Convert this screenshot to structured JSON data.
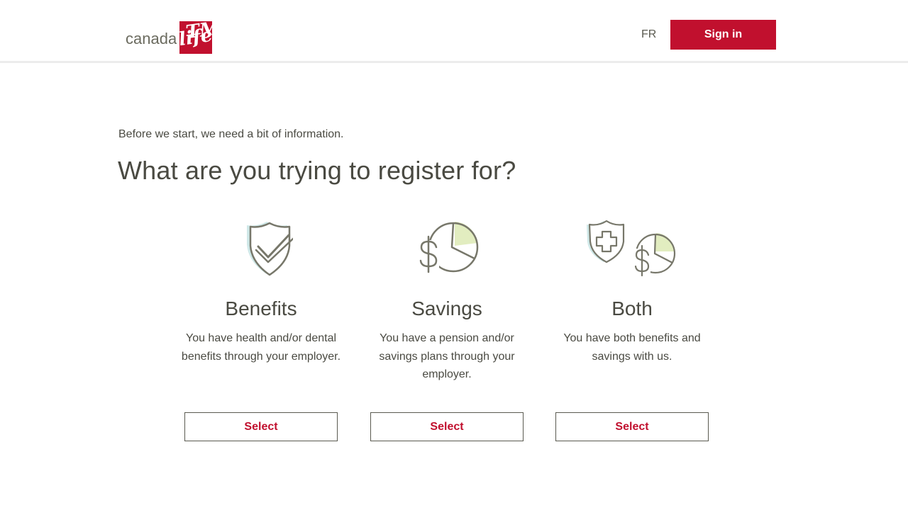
{
  "header": {
    "logo_text": "canada",
    "logo_mark": "life",
    "logo_tm": "TM",
    "lang_label": "FR",
    "signin_label": "Sign in"
  },
  "main": {
    "intro": "Before we start, we need a bit of information.",
    "title": "What are you trying to register for?",
    "options": [
      {
        "icon": "shield-check-icon",
        "title": "Benefits",
        "description": "You have health and/or dental benefits through your employer.",
        "button_label": "Select"
      },
      {
        "icon": "dollar-pie-chart-icon",
        "title": "Savings",
        "description": "You have a pension and/or savings plans through your employer.",
        "button_label": "Select"
      },
      {
        "icon": "shield-cross-dollar-pie-icon",
        "title": "Both",
        "description": "You have both benefits and savings with us.",
        "button_label": "Select"
      }
    ]
  },
  "colors": {
    "brand_red": "#c1102e",
    "text": "#4a4a42",
    "icon_stroke": "#77776a",
    "accent_blue": "#cfe8e8",
    "accent_green": "#e2edc0"
  }
}
